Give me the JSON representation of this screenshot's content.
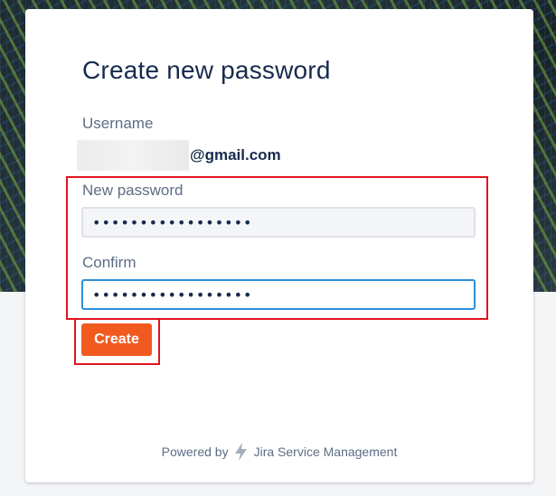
{
  "form": {
    "title": "Create new password",
    "username_label": "Username",
    "username_domain": "@gmail.com",
    "new_password_label": "New password",
    "new_password_value": "•••••••••••••••••",
    "confirm_label": "Confirm",
    "confirm_value": "•••••••••••••••••",
    "create_button": "Create"
  },
  "footer": {
    "powered_by": "Powered by",
    "product_icon": "jira-service-management-icon",
    "product_name": "Jira Service Management"
  },
  "colors": {
    "button": "#f05a1f",
    "focus_border": "#2d8ed8",
    "highlight_box": "#e0141e",
    "title": "#172b4d"
  }
}
